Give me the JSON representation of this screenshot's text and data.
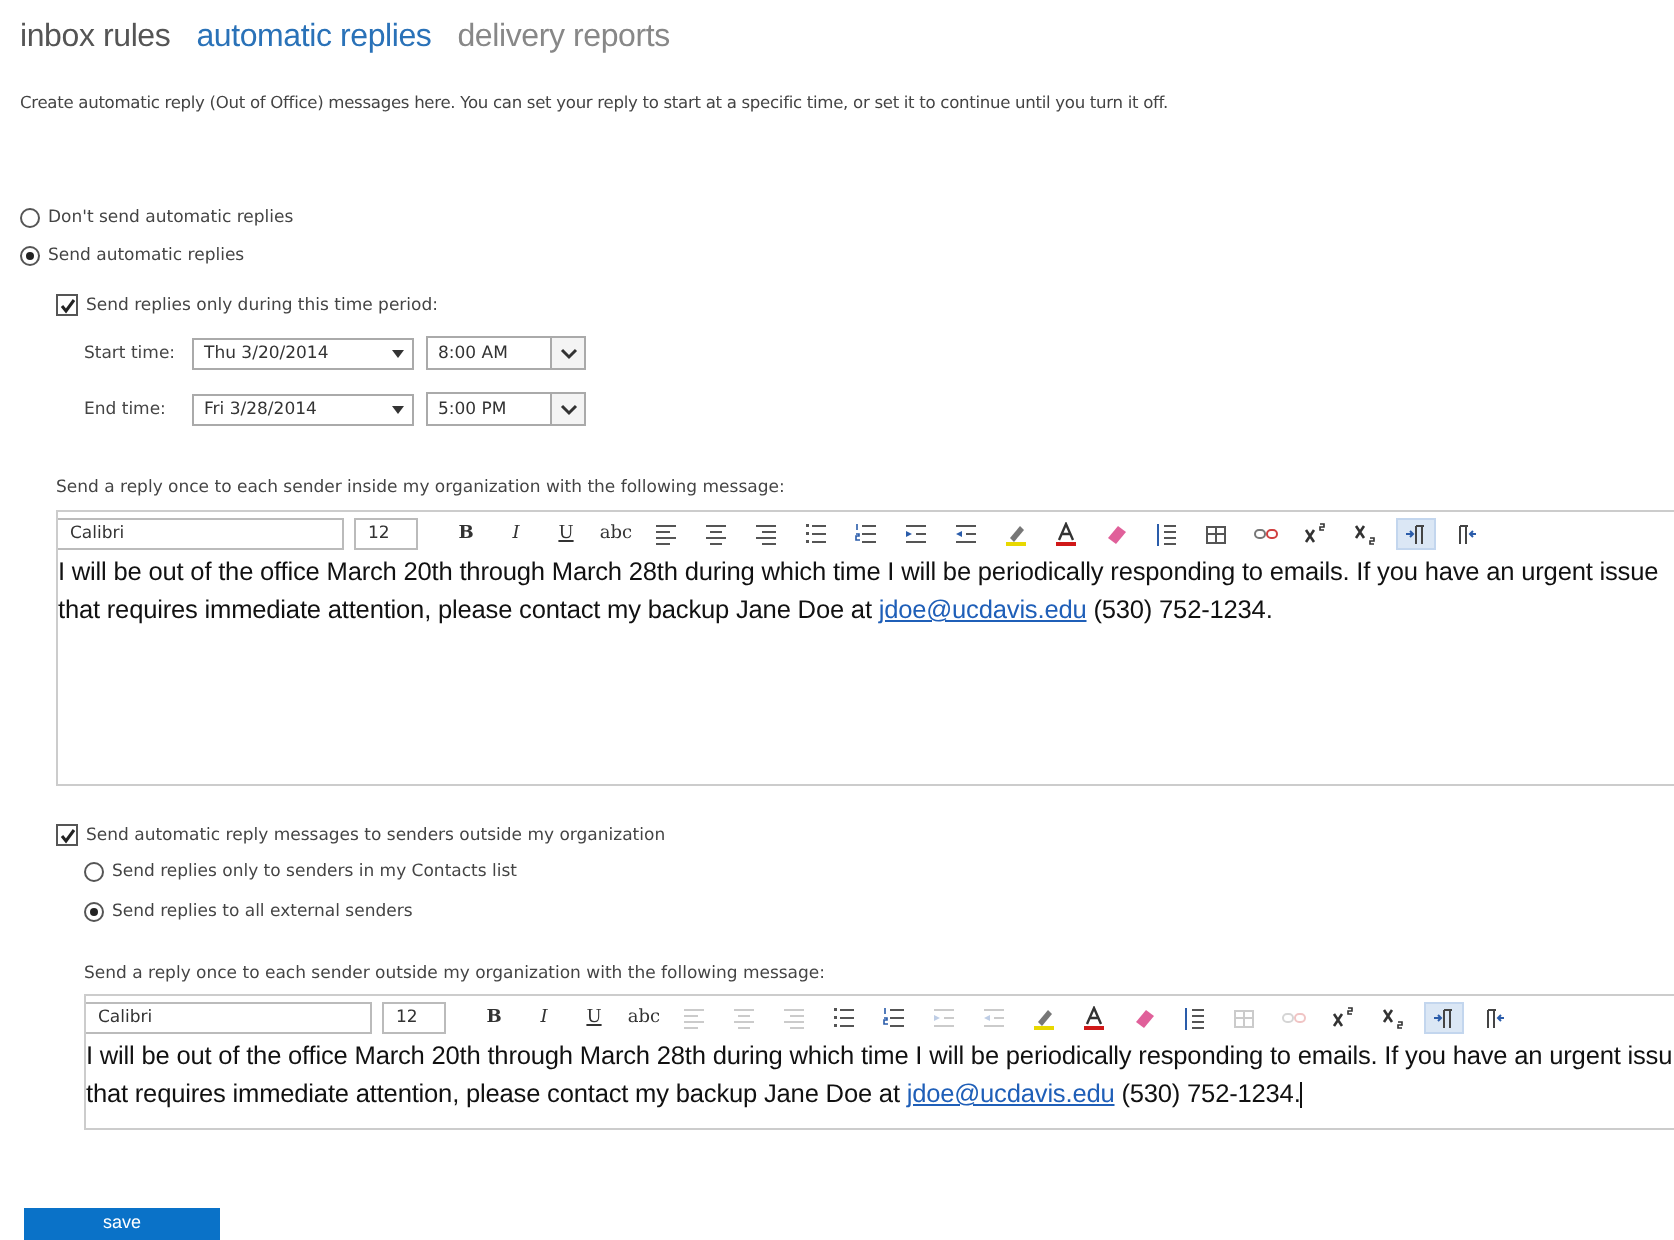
{
  "tabs": [
    {
      "label": "inbox rules",
      "selected": false
    },
    {
      "label": "automatic replies",
      "selected": true
    },
    {
      "label": "delivery reports",
      "selected": false
    }
  ],
  "description": "Create automatic reply (Out of Office) messages here. You can set your reply to start at a specific time, or set it to continue until you turn it off.",
  "reply_mode": [
    {
      "label": "Don't send automatic replies",
      "selected": false
    },
    {
      "label": "Send automatic replies",
      "selected": true
    }
  ],
  "time_period": {
    "label": "Send replies only during this time period:",
    "checked": true,
    "rows": [
      {
        "label": "Start time:",
        "date": "Thu 3/20/2014",
        "time": "8:00 AM"
      },
      {
        "label": "End time:",
        "date": "Fri 3/28/2014",
        "time": "5:00 PM"
      }
    ]
  },
  "inside_editor": {
    "label": "Send a reply once to each sender inside my organization with the following message:",
    "font": "Calibri",
    "size": "12",
    "toolbar": [
      {
        "kind": "text",
        "label": "B",
        "disabled": false,
        "selected": false
      },
      {
        "kind": "text",
        "label": "I",
        "disabled": false,
        "selected": false
      },
      {
        "kind": "text",
        "label": "U",
        "disabled": false,
        "selected": false
      },
      {
        "kind": "text",
        "label": "abc",
        "disabled": false,
        "selected": false
      },
      {
        "kind": "align-left",
        "disabled": false,
        "selected": false
      },
      {
        "kind": "align-center",
        "disabled": false,
        "selected": false
      },
      {
        "kind": "align-right",
        "disabled": false,
        "selected": false
      },
      {
        "kind": "bullets",
        "disabled": false,
        "selected": false
      },
      {
        "kind": "numbers",
        "disabled": false,
        "selected": false
      },
      {
        "kind": "indent",
        "disabled": false,
        "selected": false
      },
      {
        "kind": "outdent",
        "disabled": false,
        "selected": false
      },
      {
        "kind": "highlight",
        "disabled": false,
        "selected": false
      },
      {
        "kind": "font-color",
        "disabled": false,
        "selected": false
      },
      {
        "kind": "eraser",
        "disabled": false,
        "selected": false
      },
      {
        "kind": "spacing",
        "disabled": false,
        "selected": false
      },
      {
        "kind": "table",
        "disabled": false,
        "selected": false
      },
      {
        "kind": "link",
        "disabled": false,
        "selected": false
      },
      {
        "kind": "superscript",
        "disabled": false,
        "selected": false
      },
      {
        "kind": "subscript",
        "disabled": false,
        "selected": false
      },
      {
        "kind": "ltr",
        "disabled": false,
        "selected": true
      },
      {
        "kind": "rtl",
        "disabled": false,
        "selected": false
      }
    ],
    "lines": [
      {
        "text": "I will be out of the office March 20th through March 28th during which time I will be periodically responding to emails. If you have an urgent issue"
      },
      {
        "text": "that requires immediate attention, please contact my backup Jane Doe at ",
        "link": "jdoe@ucdavis.edu",
        "after": " (530) 752-1234."
      }
    ]
  },
  "outside": {
    "label": "Send automatic reply messages to senders outside my organization",
    "checked": true,
    "options": [
      {
        "label": "Send replies only to senders in my Contacts list",
        "selected": false
      },
      {
        "label": "Send replies to all external senders",
        "selected": true
      }
    ]
  },
  "outside_editor": {
    "label": "Send a reply once to each sender outside my organization with the following message:",
    "font": "Calibri",
    "size": "12",
    "toolbar": [
      {
        "kind": "text",
        "label": "B",
        "disabled": false,
        "selected": false
      },
      {
        "kind": "text",
        "label": "I",
        "disabled": false,
        "selected": false
      },
      {
        "kind": "text",
        "label": "U",
        "disabled": false,
        "selected": false
      },
      {
        "kind": "text",
        "label": "abc",
        "disabled": false,
        "selected": false
      },
      {
        "kind": "align-left",
        "disabled": true,
        "selected": false
      },
      {
        "kind": "align-center",
        "disabled": true,
        "selected": false
      },
      {
        "kind": "align-right",
        "disabled": true,
        "selected": false
      },
      {
        "kind": "bullets",
        "disabled": false,
        "selected": false
      },
      {
        "kind": "numbers",
        "disabled": false,
        "selected": false
      },
      {
        "kind": "indent",
        "disabled": true,
        "selected": false
      },
      {
        "kind": "outdent",
        "disabled": true,
        "selected": false
      },
      {
        "kind": "highlight",
        "disabled": false,
        "selected": false
      },
      {
        "kind": "font-color",
        "disabled": false,
        "selected": false
      },
      {
        "kind": "eraser",
        "disabled": false,
        "selected": false
      },
      {
        "kind": "spacing",
        "disabled": false,
        "selected": false
      },
      {
        "kind": "table",
        "disabled": true,
        "selected": false
      },
      {
        "kind": "link",
        "disabled": true,
        "selected": false
      },
      {
        "kind": "superscript",
        "disabled": false,
        "selected": false
      },
      {
        "kind": "subscript",
        "disabled": false,
        "selected": false
      },
      {
        "kind": "ltr",
        "disabled": false,
        "selected": true
      },
      {
        "kind": "rtl",
        "disabled": false,
        "selected": false
      }
    ],
    "lines": [
      {
        "text": "I will be out of the office March 20th through March 28th during which time I will be periodically responding to emails. If you have an urgent issu"
      },
      {
        "text": "that requires immediate attention, please contact my backup Jane Doe at ",
        "link": "jdoe@ucdavis.edu",
        "after": " (530) 752-1234."
      }
    ],
    "cursor": true
  },
  "save_button": "save"
}
